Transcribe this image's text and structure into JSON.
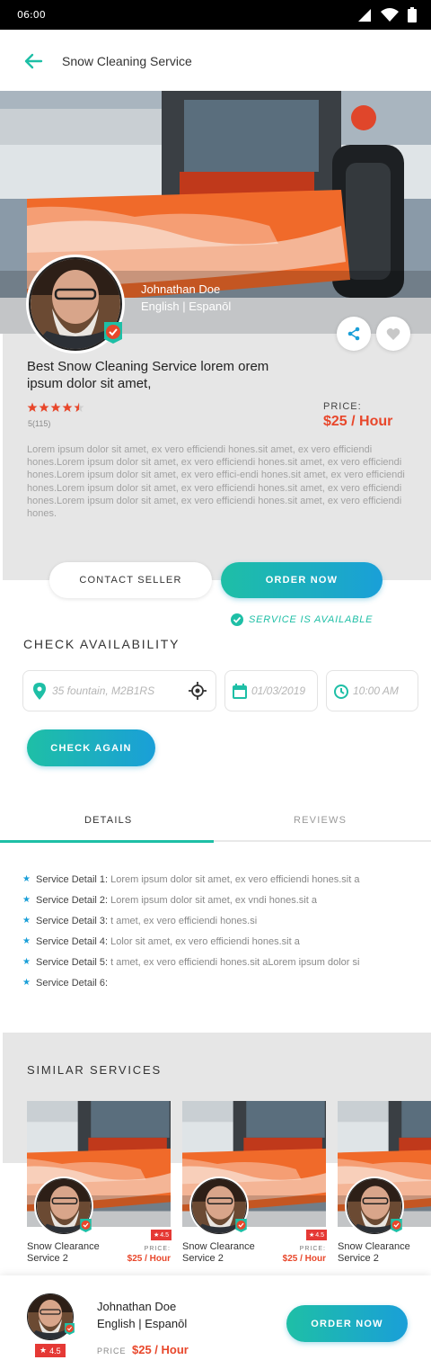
{
  "status_bar": {
    "time": "06:00"
  },
  "app_bar": {
    "title": "Snow Cleaning Service",
    "back_icon": "arrow-left-icon"
  },
  "seller": {
    "name": "Johnathan Doe",
    "languages": "English | Espanōl"
  },
  "service": {
    "title": "Best Snow Cleaning Service lorem orem ipsum dolor sit amet,",
    "rating": 4.5,
    "rating_text": "5(115)",
    "price_label": "PRICE:",
    "price": "$25 / Hour",
    "description": "Lorem ipsum dolor sit amet, ex vero efficiendi hones.sit amet, ex vero efficiendi hones.Lorem ipsum dolor sit amet, ex vero efficiendi hones.sit amet, ex vero efficiendi hones.Lorem ipsum dolor sit amet, ex vero effici-endi hones.sit amet, ex vero efficiendi hones.Lorem ipsum dolor sit amet, ex vero efficiendi hones.sit amet, ex vero efficiendi hones.Lorem ipsum dolor sit amet, ex vero efficiendi hones.sit amet, ex vero efficiendi hones."
  },
  "actions": {
    "contact_label": "CONTACT SELLER",
    "order_label": "ORDER NOW",
    "availability_text": "SERVICE IS  AVAILABLE"
  },
  "availability": {
    "title": "CHECK AVAILABILITY",
    "location": "35 fountain, M2B1RS",
    "date": "01/03/2019",
    "time": "10:00 AM",
    "check_label": "CHECK AGAIN"
  },
  "tabs": [
    {
      "label": "DETAILS",
      "active": true
    },
    {
      "label": "REVIEWS",
      "active": false
    }
  ],
  "details": [
    {
      "label": "Service Detail 1:",
      "text": "Lorem ipsum dolor sit amet, ex vero efficiendi hones.sit a"
    },
    {
      "label": "Service Detail 2:",
      "text": "Lorem ipsum dolor sit amet, ex vndi hones.sit a"
    },
    {
      "label": "Service Detail 3:",
      "text": "t amet, ex vero efficiendi hones.si"
    },
    {
      "label": "Service Detail 4:",
      "text": "Lolor sit amet, ex vero efficiendi hones.sit a"
    },
    {
      "label": "Service Detail 5:",
      "text": "t amet, ex vero efficiendi hones.sit aLorem ipsum dolor si"
    },
    {
      "label": "Service Detail 6:",
      "text": ""
    }
  ],
  "similar": {
    "title": "SIMILAR SERVICES",
    "cards": [
      {
        "title": "Snow Clearance Service 2",
        "rating": "4.5",
        "price_label": "PRICE:",
        "price": "$25 / Hour"
      },
      {
        "title": "Snow Clearance Service 2",
        "rating": "4.5",
        "price_label": "PRICE:",
        "price": "$25 / Hour"
      },
      {
        "title": "Snow Clearance Service 2",
        "rating": "",
        "price_label": "",
        "price": ""
      }
    ]
  },
  "bottom_bar": {
    "name": "Johnathan Doe",
    "languages": "English | Espanōl",
    "rating": "4.5",
    "price_label": "PRICE",
    "price": "$25 / Hour",
    "order_label": "ORDER NOW"
  },
  "colors": {
    "accent_teal": "#1ebfa6",
    "accent_blue": "#1a9fd8",
    "price_red": "#e8472b",
    "badge_red": "#e53935"
  }
}
